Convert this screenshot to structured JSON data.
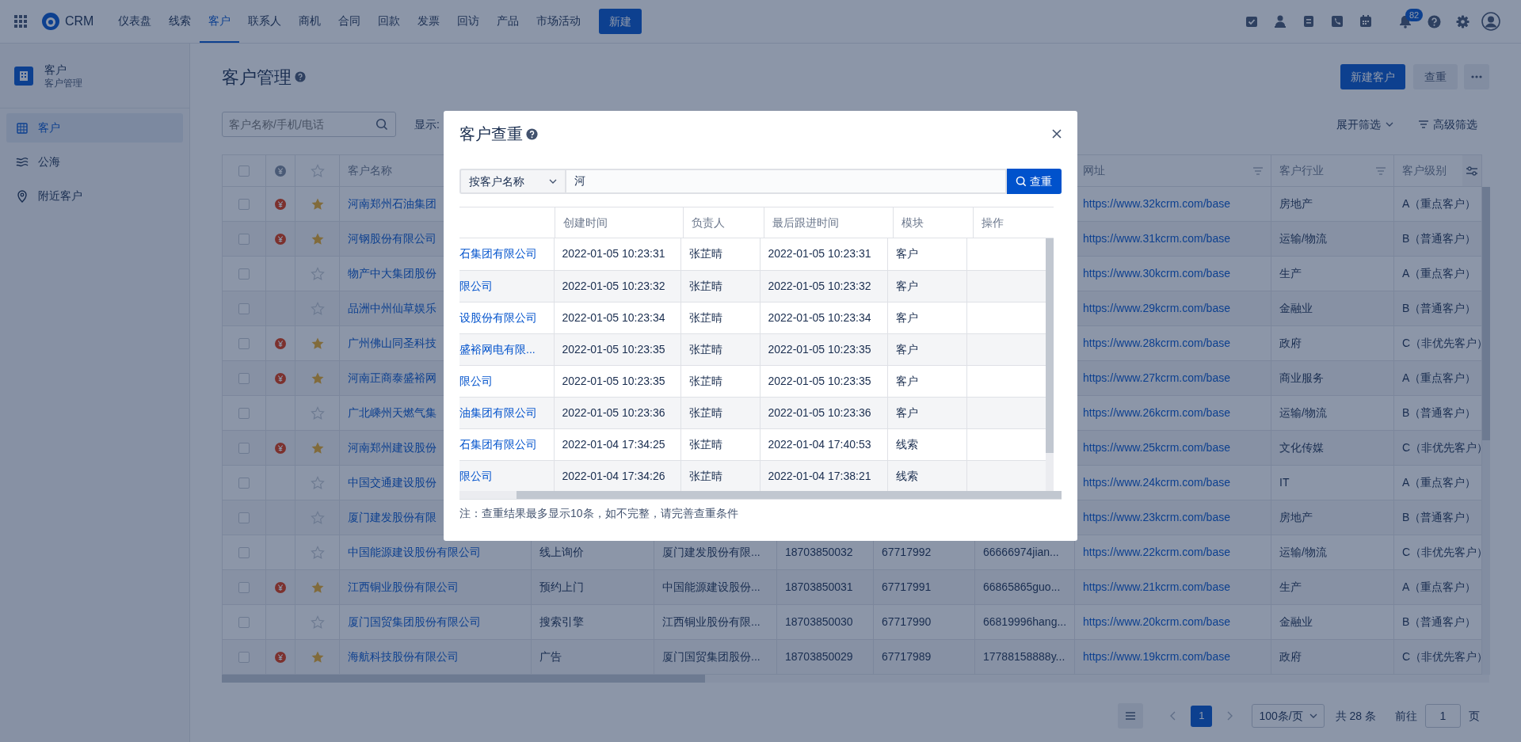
{
  "nav": {
    "app_name": "CRM",
    "menu": [
      {
        "label": "仪表盘",
        "selected": false
      },
      {
        "label": "线索",
        "selected": false
      },
      {
        "label": "客户",
        "selected": true
      },
      {
        "label": "联系人",
        "selected": false
      },
      {
        "label": "商机",
        "selected": false
      },
      {
        "label": "合同",
        "selected": false
      },
      {
        "label": "回款",
        "selected": false
      },
      {
        "label": "发票",
        "selected": false
      },
      {
        "label": "回访",
        "selected": false
      },
      {
        "label": "产品",
        "selected": false
      },
      {
        "label": "市场活动",
        "selected": false
      }
    ],
    "new_button": "新建",
    "notification_count": "82"
  },
  "sidebar": {
    "title": "客户",
    "subtitle": "客户管理",
    "items": [
      {
        "label": "客户",
        "kind": "building",
        "selected": true
      },
      {
        "label": "公海",
        "kind": "waves",
        "selected": false
      },
      {
        "label": "附近客户",
        "kind": "pin",
        "selected": false
      }
    ]
  },
  "page": {
    "title": "客户管理",
    "new_button": "新建客户",
    "dedupe_button": "查重"
  },
  "filters": {
    "search_placeholder": "客户名称/手机/电话",
    "display_label": "显示:",
    "expand": "展开筛选",
    "advanced": "高级筛选"
  },
  "table": {
    "select_all_checked": false,
    "columns": [
      {
        "label": "客户名称"
      },
      null,
      null,
      null,
      null,
      null,
      {
        "label": "网址",
        "filter": true
      },
      {
        "label": "客户行业",
        "filter": true
      },
      {
        "label": "客户级别"
      }
    ],
    "rows": [
      {
        "checked": false,
        "deal": true,
        "starred": true,
        "cells": [
          "河南郑州石油集团",
          null,
          null,
          null,
          null,
          null,
          "https://www.32kcrm.com/base",
          "房地产",
          "A（重点客户）"
        ]
      },
      {
        "checked": false,
        "deal": true,
        "starred": true,
        "cells": [
          "河钢股份有限公司",
          null,
          null,
          null,
          null,
          null,
          "https://www.31kcrm.com/base",
          "运输/物流",
          "B（普通客户）"
        ]
      },
      {
        "checked": false,
        "deal": false,
        "starred": false,
        "cells": [
          "物产中大集团股份",
          null,
          null,
          null,
          null,
          null,
          "https://www.30kcrm.com/base",
          "生产",
          "A（重点客户）"
        ]
      },
      {
        "checked": false,
        "deal": false,
        "starred": false,
        "cells": [
          "品洲中州仙草娱乐",
          null,
          null,
          null,
          null,
          null,
          "https://www.29kcrm.com/base",
          "金融业",
          "B（普通客户）"
        ]
      },
      {
        "checked": false,
        "deal": true,
        "starred": true,
        "cells": [
          "广州佛山同圣科技",
          null,
          null,
          null,
          null,
          null,
          "https://www.28kcrm.com/base",
          "政府",
          "C（非优先客户）"
        ]
      },
      {
        "checked": false,
        "deal": true,
        "starred": true,
        "cells": [
          "河南正商泰盛裕网",
          null,
          null,
          null,
          null,
          null,
          "https://www.27kcrm.com/base",
          "商业服务",
          "A（重点客户）"
        ]
      },
      {
        "checked": false,
        "deal": false,
        "starred": false,
        "cells": [
          "广北嵊州天燃气集",
          null,
          null,
          null,
          null,
          null,
          "https://www.26kcrm.com/base",
          "运输/物流",
          "B（普通客户）"
        ]
      },
      {
        "checked": false,
        "deal": true,
        "starred": true,
        "cells": [
          "河南郑州建设股份",
          null,
          null,
          null,
          null,
          null,
          "https://www.25kcrm.com/base",
          "文化传媒",
          "C（非优先客户）"
        ]
      },
      {
        "checked": false,
        "deal": false,
        "starred": false,
        "cells": [
          "中国交通建设股份",
          null,
          null,
          null,
          null,
          null,
          "https://www.24kcrm.com/base",
          "IT",
          "A（重点客户）"
        ]
      },
      {
        "checked": false,
        "deal": false,
        "starred": false,
        "cells": [
          "厦门建发股份有限",
          null,
          null,
          null,
          null,
          null,
          "https://www.23kcrm.com/base",
          "房地产",
          "B（普通客户）"
        ]
      },
      {
        "checked": false,
        "deal": false,
        "starred": false,
        "cells": [
          "中国能源建设股份有限公司",
          "线上询价",
          "厦门建发股份有限...",
          "18703850032",
          "67717992",
          "66666974jian...",
          "https://www.22kcrm.com/base",
          "运输/物流",
          "C（非优先客户）"
        ]
      },
      {
        "checked": false,
        "deal": true,
        "starred": true,
        "cells": [
          "江西铜业股份有限公司",
          "预约上门",
          "中国能源建设股份...",
          "18703850031",
          "67717991",
          "66865865guo...",
          "https://www.21kcrm.com/base",
          "生产",
          "A（重点客户）"
        ]
      },
      {
        "checked": false,
        "deal": false,
        "starred": false,
        "cells": [
          "厦门国贸集团股份有限公司",
          "搜索引擎",
          "江西铜业股份有限...",
          "18703850030",
          "67717990",
          "66819996hang...",
          "https://www.20kcrm.com/base",
          "金融业",
          "B（普通客户）"
        ]
      },
      {
        "checked": false,
        "deal": true,
        "starred": true,
        "cells": [
          "海航科技股份有限公司",
          "广告",
          "厦门国贸集团股份...",
          "18703850029",
          "67717989",
          "17788158888y...",
          "https://www.19kcrm.com/base",
          "政府",
          "C（非优先客户）"
        ]
      }
    ]
  },
  "pagination": {
    "page": "1",
    "page_size": "100条/页",
    "total": "共 28 条",
    "goto_label": "前往",
    "goto_value": "1",
    "page_suffix": "页"
  },
  "modal": {
    "title": "客户查重",
    "search_by": "按客户名称",
    "query": "河",
    "search_button": "查重",
    "columns": [
      null,
      "创建时间",
      "负责人",
      "最后跟进时间",
      "模块",
      "操作"
    ],
    "rows": [
      {
        "name": "石集团有限公司",
        "created": "2022-01-05 10:23:31",
        "owner": "张芷晴",
        "last_follow": "2022-01-05 10:23:31",
        "module": "客户"
      },
      {
        "name": "限公司",
        "created": "2022-01-05 10:23:32",
        "owner": "张芷晴",
        "last_follow": "2022-01-05 10:23:32",
        "module": "客户"
      },
      {
        "name": "设股份有限公司",
        "created": "2022-01-05 10:23:34",
        "owner": "张芷晴",
        "last_follow": "2022-01-05 10:23:34",
        "module": "客户"
      },
      {
        "name": "盛裕网电有限...",
        "created": "2022-01-05 10:23:35",
        "owner": "张芷晴",
        "last_follow": "2022-01-05 10:23:35",
        "module": "客户"
      },
      {
        "name": "限公司",
        "created": "2022-01-05 10:23:35",
        "owner": "张芷晴",
        "last_follow": "2022-01-05 10:23:35",
        "module": "客户"
      },
      {
        "name": "油集团有限公司",
        "created": "2022-01-05 10:23:36",
        "owner": "张芷晴",
        "last_follow": "2022-01-05 10:23:36",
        "module": "客户"
      },
      {
        "name": "石集团有限公司",
        "created": "2022-01-04 17:34:25",
        "owner": "张芷晴",
        "last_follow": "2022-01-04 17:40:53",
        "module": "线索"
      },
      {
        "name": "限公司",
        "created": "2022-01-04 17:34:26",
        "owner": "张芷晴",
        "last_follow": "2022-01-04 17:38:21",
        "module": "线索"
      }
    ],
    "note": "注：查重结果最多显示10条，如不完整，请完善查重条件"
  }
}
